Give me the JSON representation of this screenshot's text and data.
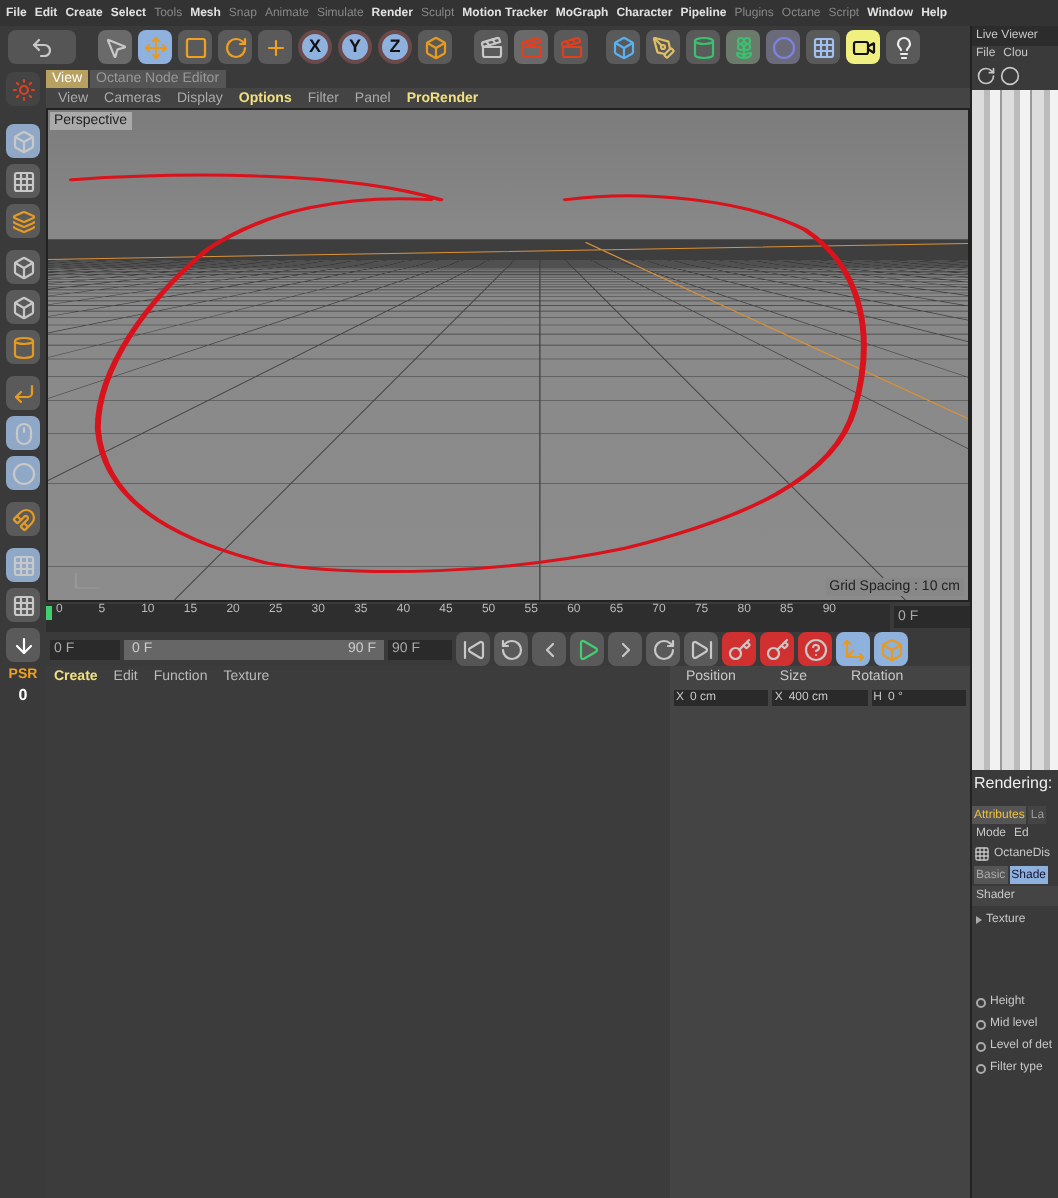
{
  "menu": [
    {
      "label": "File",
      "disabled": false
    },
    {
      "label": "Edit",
      "disabled": false
    },
    {
      "label": "Create",
      "disabled": false
    },
    {
      "label": "Select",
      "disabled": false
    },
    {
      "label": "Tools",
      "disabled": true
    },
    {
      "label": "Mesh",
      "disabled": false
    },
    {
      "label": "Snap",
      "disabled": true
    },
    {
      "label": "Animate",
      "disabled": true
    },
    {
      "label": "Simulate",
      "disabled": true
    },
    {
      "label": "Render",
      "disabled": false
    },
    {
      "label": "Sculpt",
      "disabled": true
    },
    {
      "label": "Motion Tracker",
      "disabled": false
    },
    {
      "label": "MoGraph",
      "disabled": false
    },
    {
      "label": "Character",
      "disabled": false
    },
    {
      "label": "Pipeline",
      "disabled": false
    },
    {
      "label": "Plugins",
      "disabled": true
    },
    {
      "label": "Octane",
      "disabled": true
    },
    {
      "label": "Script",
      "disabled": true
    },
    {
      "label": "Window",
      "disabled": false
    },
    {
      "label": "Help",
      "disabled": false
    }
  ],
  "toolbar": {
    "axis_buttons": [
      "X",
      "Y",
      "Z"
    ]
  },
  "left_toolbar": {
    "psr_label": "PSR",
    "psr_value": "0"
  },
  "viewport": {
    "tabs": [
      {
        "label": "View",
        "selected": true
      },
      {
        "label": "Octane Node Editor",
        "selected": false
      }
    ],
    "menu": [
      {
        "label": "View",
        "highlighted": false
      },
      {
        "label": "Cameras",
        "highlighted": false
      },
      {
        "label": "Display",
        "highlighted": false
      },
      {
        "label": "Options",
        "highlighted": true
      },
      {
        "label": "Filter",
        "highlighted": false
      },
      {
        "label": "Panel",
        "highlighted": false
      },
      {
        "label": "ProRender",
        "highlighted": true
      }
    ],
    "camera_label": "Perspective",
    "grid_spacing": "Grid Spacing : 10 cm"
  },
  "timeline": {
    "ticks": [
      "0",
      "5",
      "10",
      "15",
      "20",
      "25",
      "30",
      "35",
      "40",
      "45",
      "50",
      "55",
      "60",
      "65",
      "70",
      "75",
      "80",
      "85",
      "90"
    ],
    "current_frame": "0 F"
  },
  "transport": {
    "start_field": "0 F",
    "range_slider": {
      "start": "0 F",
      "end": "90 F",
      "level": 1
    },
    "end_field": "90 F"
  },
  "materials_menu": [
    {
      "label": "Create",
      "highlighted": true
    },
    {
      "label": "Edit",
      "highlighted": false
    },
    {
      "label": "Function",
      "highlighted": false
    },
    {
      "label": "Texture",
      "highlighted": false
    }
  ],
  "coordinates": {
    "headers": [
      "Position",
      "Size",
      "Rotation"
    ],
    "fields": [
      {
        "axis": "X",
        "value": "0 cm"
      },
      {
        "axis": "X",
        "value": "400 cm"
      },
      {
        "axis": "H",
        "value": "0 °"
      }
    ]
  },
  "right_panel": {
    "title": "Live Viewer",
    "menu": [
      "File",
      "Clou"
    ],
    "status": "Rendering:",
    "attr_tabs": [
      {
        "label": "Attributes",
        "selected": true
      },
      {
        "label": "La",
        "selected": false
      }
    ],
    "attr_menu": [
      "Mode",
      "Ed"
    ],
    "object_name": "OctaneDis",
    "sub_tabs": [
      {
        "label": "Basic",
        "selected": false
      },
      {
        "label": "Shade",
        "selected": true
      }
    ],
    "section": "Shader",
    "params": [
      {
        "kind": "texture",
        "label": "Texture"
      },
      {
        "kind": "value",
        "label": "Height"
      },
      {
        "kind": "value",
        "label": "Mid level"
      },
      {
        "kind": "value",
        "label": "Level of det"
      },
      {
        "kind": "value",
        "label": "Filter type"
      }
    ]
  }
}
